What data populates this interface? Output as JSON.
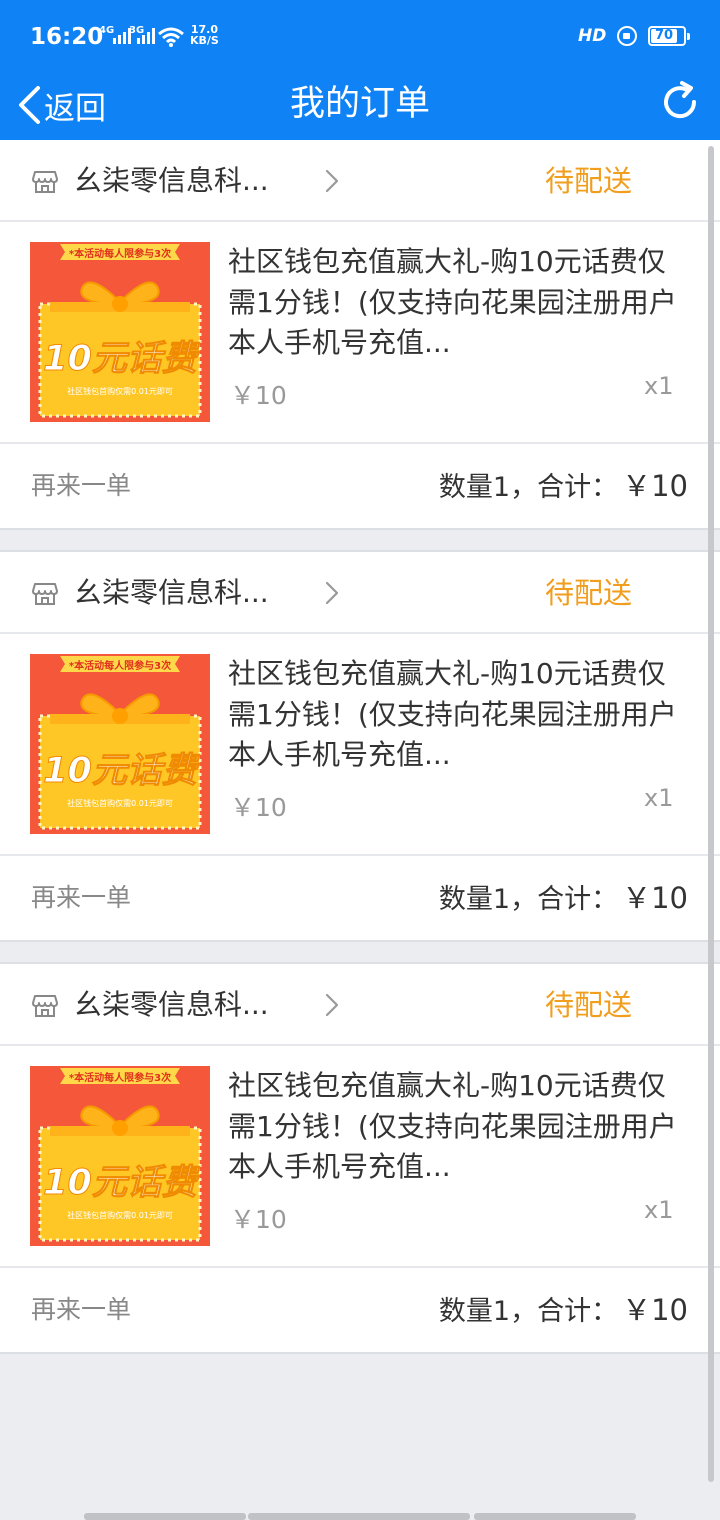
{
  "status_bar": {
    "time": "16:20",
    "net1": "4G",
    "net2": "3G",
    "speed_value": "17.0",
    "speed_unit": "KB/S",
    "hd": "HD",
    "battery": "70"
  },
  "nav": {
    "back_label": "返回",
    "title": "我的订单",
    "back_icon": "chevron-left-icon",
    "refresh_icon": "refresh-icon"
  },
  "colors": {
    "brand_blue": "#0f82f5",
    "status_orange": "#f19e1f",
    "banner_red": "#f4573a",
    "banner_yellow": "#ffc726"
  },
  "product_image": {
    "top_banner": "*本活动每人限参与3次",
    "headline": "10元话费",
    "bottom_text": "社区钱包首购仅需0.01元即可"
  },
  "orders": [
    {
      "shop": "幺柒零信息科...",
      "status": "待配送",
      "product_title": "社区钱包充值赢大礼-购10元话费仅需1分钱！(仅支持向花果园注册用户本人手机号充值...",
      "price": "￥10",
      "qty": "x1",
      "reorder": "再来一单",
      "summary_label": "数量1，合计：",
      "total": "￥10"
    },
    {
      "shop": "幺柒零信息科...",
      "status": "待配送",
      "product_title": "社区钱包充值赢大礼-购10元话费仅需1分钱！(仅支持向花果园注册用户本人手机号充值...",
      "price": "￥10",
      "qty": "x1",
      "reorder": "再来一单",
      "summary_label": "数量1，合计：",
      "total": "￥10"
    },
    {
      "shop": "幺柒零信息科...",
      "status": "待配送",
      "product_title": "社区钱包充值赢大礼-购10元话费仅需1分钱！(仅支持向花果园注册用户本人手机号充值...",
      "price": "￥10",
      "qty": "x1",
      "reorder": "再来一单",
      "summary_label": "数量1，合计：",
      "total": "￥10"
    }
  ]
}
